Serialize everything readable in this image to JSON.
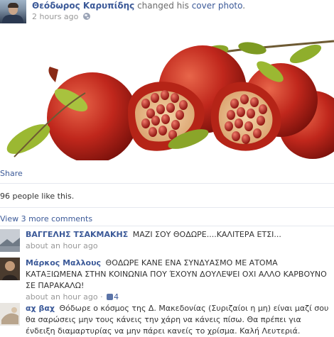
{
  "post": {
    "author": "Θεόδωρος Καρυπίδης",
    "action_prefix": "changed his",
    "action_link": "cover photo",
    "action_suffix": ".",
    "timestamp": "2 hours ago",
    "privacy_icon": "globe-icon"
  },
  "cover_photo": {
    "subject": "pomegranates",
    "colors": {
      "fruit": "#c0271c",
      "seed": "#8e1410",
      "leaf": "#7d9a22",
      "background": "#ffffff"
    }
  },
  "actions": {
    "share_label": "Share",
    "likes_text": "96 people like this.",
    "view_more_label": "View 3 more comments"
  },
  "comments": [
    {
      "author": "ΒΑΓΓΕΛΗΣ ΤΣΑΚΜΑΚΗΣ",
      "text": "ΜΑΖΙ ΣΟΥ ΘΟΔΩΡΕ....ΚΑΛΙΤΕΡΑ ΕΤΣΙ...",
      "time": "about an hour ago"
    },
    {
      "author": "Μάρκος Μαλλους",
      "text": "ΘΟΔΩΡΕ ΚΑΝΕ ΕΝΑ ΣΥΝΔΥΑΣΜΟ ΜΕ ΑΤΟΜΑ ΚΑΤΑΞΙΩΜΕΝΑ ΣΤΗΝ ΚΟΙΝΩΝΙΑ ΠΟΥ ΈΧΟΥΝ ΔΟΥΛΕΨΕΙ ΟΧΙ ΑΛΛΟ ΚΑΡΒΟΥΝΟ ΣΕ ΠΑΡΑΚΑΛΩ!",
      "time": "about an hour ago",
      "separator": " · ",
      "likes": "4"
    },
    {
      "author": "αχ βαχ",
      "text": "Θόδωρε ο κόσμος της Δ. Μακεδονίας (Συριζαίοι η μη) είναι μαζί σου θα σαρώσεις μην τους κάνεις την χάρη να κάνεις πίσω. Θα πρέπει για ένδειξη διαμαρτυρίας να μην πάρει κανείς το χρίσμα. Καλή Λευτεριά."
    }
  ]
}
